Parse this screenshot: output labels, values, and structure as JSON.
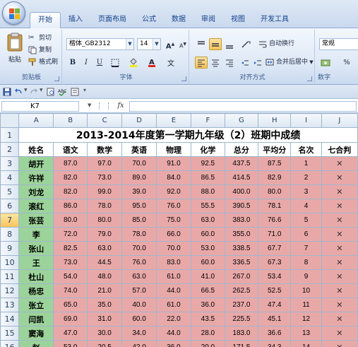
{
  "ribbon": {
    "tabs": [
      "开始",
      "插入",
      "页面布局",
      "公式",
      "数据",
      "审阅",
      "视图",
      "开发工具"
    ],
    "clipboard": {
      "label": "剪贴板",
      "paste": "粘贴",
      "cut": "剪切",
      "copy": "复制",
      "format_painter": "格式刷"
    },
    "font": {
      "label": "字体",
      "family": "楷体_GB2312",
      "size": "14",
      "grow": "A",
      "shrink": "A",
      "bold": "B",
      "italic": "I",
      "underline": "U"
    },
    "alignment": {
      "label": "对齐方式",
      "wrap": "自动换行",
      "merge": "合并后居中"
    },
    "number": {
      "label": "数字",
      "format": "常规",
      "percent": "%"
    }
  },
  "formula_bar": {
    "name_box": "K7",
    "fx": "fx",
    "value": ""
  },
  "sheet": {
    "columns": [
      "A",
      "B",
      "C",
      "D",
      "E",
      "F",
      "G",
      "H",
      "I",
      "J"
    ],
    "selected_row": "7",
    "title": "2013-2014年度第一学期九年级（2）班期中成绩",
    "headers": [
      "姓名",
      "语文",
      "数学",
      "英语",
      "物理",
      "化学",
      "总分",
      "平均分",
      "名次",
      "七合判"
    ],
    "rows": [
      [
        "胡开",
        "87.0",
        "97.0",
        "70.0",
        "91.0",
        "92.5",
        "437.5",
        "87.5",
        "1",
        "✕"
      ],
      [
        "许祥",
        "82.0",
        "73.0",
        "89.0",
        "84.0",
        "86.5",
        "414.5",
        "82.9",
        "2",
        "✕"
      ],
      [
        "刘龙",
        "82.0",
        "99.0",
        "39.0",
        "92.0",
        "88.0",
        "400.0",
        "80.0",
        "3",
        "✕"
      ],
      [
        "滚红",
        "86.0",
        "78.0",
        "95.0",
        "76.0",
        "55.5",
        "390.5",
        "78.1",
        "4",
        "✕"
      ],
      [
        "张芸",
        "80.0",
        "80.0",
        "85.0",
        "75.0",
        "63.0",
        "383.0",
        "76.6",
        "5",
        "✕"
      ],
      [
        "李",
        "72.0",
        "79.0",
        "78.0",
        "66.0",
        "60.0",
        "355.0",
        "71.0",
        "6",
        "✕"
      ],
      [
        "张山",
        "82.5",
        "63.0",
        "70.0",
        "70.0",
        "53.0",
        "338.5",
        "67.7",
        "7",
        "✕"
      ],
      [
        "王",
        "73.0",
        "44.5",
        "76.0",
        "83.0",
        "60.0",
        "336.5",
        "67.3",
        "8",
        "✕"
      ],
      [
        "杜山",
        "54.0",
        "48.0",
        "63.0",
        "61.0",
        "41.0",
        "267.0",
        "53.4",
        "9",
        "✕"
      ],
      [
        "杨忠",
        "74.0",
        "21.0",
        "57.0",
        "44.0",
        "66.5",
        "262.5",
        "52.5",
        "10",
        "✕"
      ],
      [
        "张立",
        "65.0",
        "35.0",
        "40.0",
        "61.0",
        "36.0",
        "237.0",
        "47.4",
        "11",
        "✕"
      ],
      [
        "闫凯",
        "69.0",
        "31.0",
        "60.0",
        "22.0",
        "43.5",
        "225.5",
        "45.1",
        "12",
        "✕"
      ],
      [
        "窦海",
        "47.0",
        "30.0",
        "34.0",
        "44.0",
        "28.0",
        "183.0",
        "36.6",
        "13",
        "✕"
      ],
      [
        "赵",
        "53.0",
        "20.5",
        "42.0",
        "36.0",
        "20.0",
        "171.5",
        "34.3",
        "14",
        "✕"
      ]
    ]
  },
  "colors": {
    "name_fill": "#9cd39a",
    "score_fill": "#e9a8a8",
    "grid_line": "#9eb6ce"
  }
}
